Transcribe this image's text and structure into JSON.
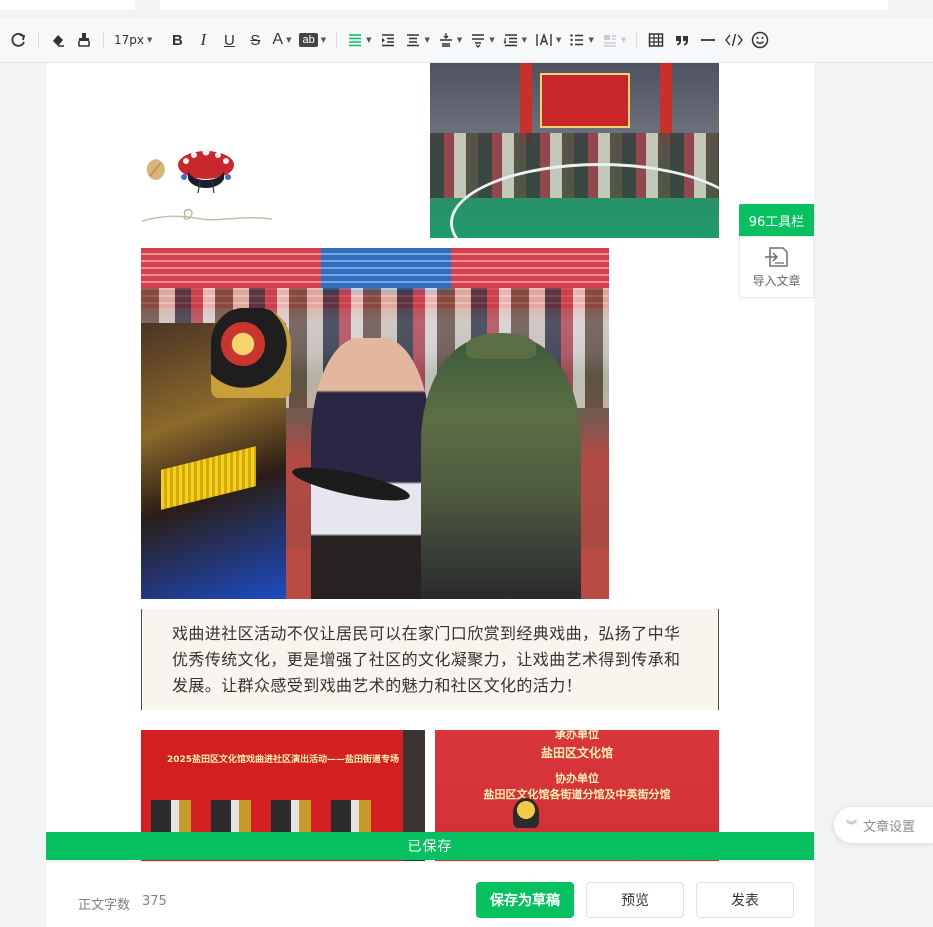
{
  "toolbar": {
    "font_size": "17px",
    "icons": [
      "redo-icon",
      "clear-format-icon",
      "format-painter-icon",
      "bold-icon",
      "italic-icon",
      "underline-icon",
      "strikethrough-icon",
      "font-color-icon",
      "background-color-icon",
      "align-left-icon",
      "indent-icon",
      "align-center-icon",
      "vertical-align-icon",
      "line-spacing-icon",
      "paragraph-spacing-icon",
      "letter-spacing-icon",
      "list-icon",
      "image-layout-icon",
      "table-icon",
      "quote-icon",
      "divider-icon",
      "code-icon",
      "emoji-icon"
    ],
    "labels": {
      "bold": "B",
      "italic": "I",
      "underline": "U",
      "strike": "S",
      "font_color": "A",
      "bg_color": "ab"
    }
  },
  "side_panel": {
    "toolbar_tab": "96工具栏",
    "import_label": "导入文章"
  },
  "article": {
    "quote_text": "戏曲进社区活动不仅让居民可以在家门口欣赏到经典戏曲，弘扬了中华优秀传统文化，更是增强了社区的文化凝聚力，让戏曲艺术得到传承和发展。让群众感受到戏曲艺术的魅力和社区文化的活力！",
    "image1_caption": "2025盐田区文化馆戏曲进社区演出活动——盐田街道专场",
    "image2_lines": [
      "承办单位",
      "盐田区文化馆",
      "协办单位",
      "盐田区文化馆各街道分馆及中英街分馆"
    ]
  },
  "status": {
    "saved": "已保存"
  },
  "footer": {
    "word_count_label": "正文字数",
    "word_count": "375",
    "save_draft": "保存为草稿",
    "preview": "预览",
    "publish": "发表"
  },
  "floating": {
    "article_settings": "文章设置"
  },
  "colors": {
    "accent": "#07c160",
    "quote_bg": "#f8f5ee",
    "text": "#333333"
  }
}
